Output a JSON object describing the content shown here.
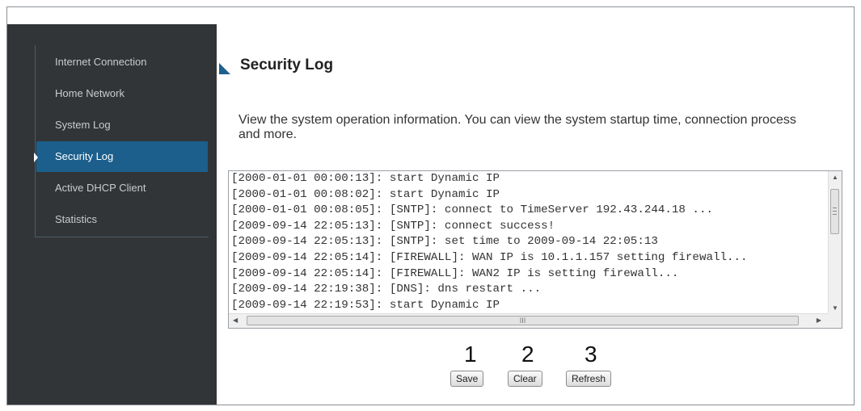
{
  "sidebar": {
    "items": [
      {
        "label": "Internet Connection",
        "active": false
      },
      {
        "label": "Home Network",
        "active": false
      },
      {
        "label": "System Log",
        "active": false
      },
      {
        "label": "Security Log",
        "active": true
      },
      {
        "label": "Active DHCP Client",
        "active": false
      },
      {
        "label": "Statistics",
        "active": false
      }
    ]
  },
  "main": {
    "title": "Security Log",
    "description": "View the system operation information. You can view the system startup time, connection process and more.",
    "log_lines": [
      "[2000-01-01 00:00:13]: start Dynamic IP",
      "[2000-01-01 00:08:02]: start Dynamic IP",
      "[2000-01-01 00:08:05]: [SNTP]: connect to TimeServer 192.43.244.18 ...",
      "[2009-09-14 22:05:13]: [SNTP]: connect success!",
      "[2009-09-14 22:05:13]: [SNTP]: set time to 2009-09-14 22:05:13",
      "[2009-09-14 22:05:14]: [FIREWALL]: WAN IP is 10.1.1.157 setting firewall...",
      "[2009-09-14 22:05:14]: [FIREWALL]: WAN2 IP is setting firewall...",
      "[2009-09-14 22:19:38]: [DNS]: dns restart ...",
      "[2009-09-14 22:19:53]: start Dynamic IP"
    ],
    "hscroll_grip": "III"
  },
  "callouts": {
    "one": "1",
    "two": "2",
    "three": "3"
  },
  "buttons": {
    "save": "Save",
    "clear": "Clear",
    "refresh": "Refresh"
  },
  "colors": {
    "active_nav": "#1c5f8c",
    "sidebar_bg": "#323537",
    "topbar": "#1d5a80"
  },
  "icons": {
    "title": "triangle-marker-icon",
    "active_item": "caret-right-icon"
  }
}
